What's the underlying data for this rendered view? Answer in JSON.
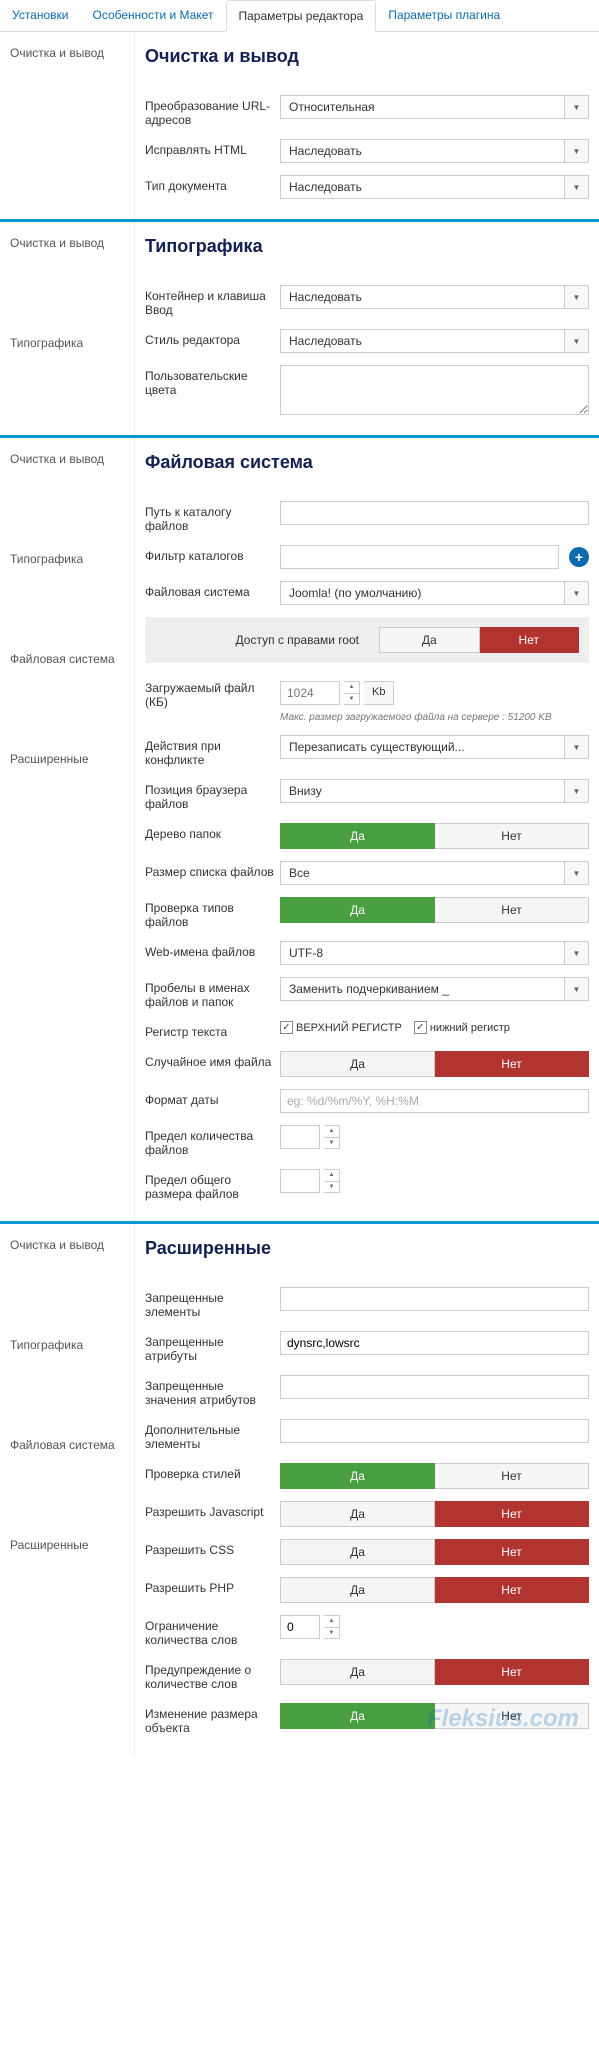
{
  "tabs": {
    "t1": "Установки",
    "t2": "Особенности и Макет",
    "t3": "Параметры редактора",
    "t4": "Параметры плагина"
  },
  "nav": {
    "clean": "Очистка и вывод",
    "typo": "Типографика",
    "fs": "Файловая система",
    "adv": "Расширенные"
  },
  "s1": {
    "title": "Очистка и вывод",
    "url_label": "Преобразование URL-адресов",
    "url_val": "Относительная",
    "fix_label": "Исправлять HTML",
    "fix_val": "Наследовать",
    "doc_label": "Тип документа",
    "doc_val": "Наследовать"
  },
  "s2": {
    "title": "Типографика",
    "cont_label": "Контейнер и клавиша Ввод",
    "cont_val": "Наследовать",
    "style_label": "Стиль редактора",
    "style_val": "Наследовать",
    "colors_label": "Пользовательские цвета"
  },
  "s3": {
    "title": "Файловая система",
    "path_label": "Путь к каталогу файлов",
    "filter_label": "Фильтр каталогов",
    "fs_label": "Файловая система",
    "fs_val": "Joomla! (по умолчанию)",
    "root_label": "Доступ с правами root",
    "yes": "Да",
    "no": "Нет",
    "upl_label": "Загружаемый файл (КБ)",
    "upl_ph": "1024",
    "upl_unit": "Kb",
    "upl_hint": "Макс. размер загружаемого файла на сервере : 51200 KB",
    "conflict_label": "Действия при конфликте",
    "conflict_val": "Перезаписать существующий...",
    "pos_label": "Позиция браузера файлов",
    "pos_val": "Внизу",
    "tree_label": "Дерево папок",
    "listsize_label": "Размер списка файлов",
    "listsize_val": "Все",
    "check_label": "Проверка типов файлов",
    "web_label": "Web-имена файлов",
    "web_val": "UTF-8",
    "spaces_label": "Пробелы в именах файлов и папок",
    "spaces_val": "Заменить подчеркиванием _",
    "case_label": "Регистр текста",
    "case_upper": "ВЕРХНИЙ РЕГИСТР",
    "case_lower": "нижний регистр",
    "rand_label": "Случайное имя файла",
    "date_label": "Формат даты",
    "date_ph": "eg: %d/%m/%Y, %H:%M",
    "limfiles_label": "Предел количества файлов",
    "limsize_label": "Предел общего размера файлов"
  },
  "s4": {
    "title": "Расширенные",
    "bel_label": "Запрещенные элементы",
    "battr_label": "Запрещенные атрибуты",
    "battr_val": "dynsrc,lowsrc",
    "bval_label": "Запрещенные значения атрибутов",
    "addel_label": "Дополнительные элементы",
    "styles_label": "Проверка стилей",
    "js_label": "Разрешить Javascript",
    "css_label": "Разрешить CSS",
    "php_label": "Разрешить PHP",
    "wlim_label": "Ограничение количества слов",
    "wlim_val": "0",
    "warn_label": "Предупреждение о количестве слов",
    "resize_label": "Изменение размера объекта"
  },
  "watermark": "Fleksius.com"
}
